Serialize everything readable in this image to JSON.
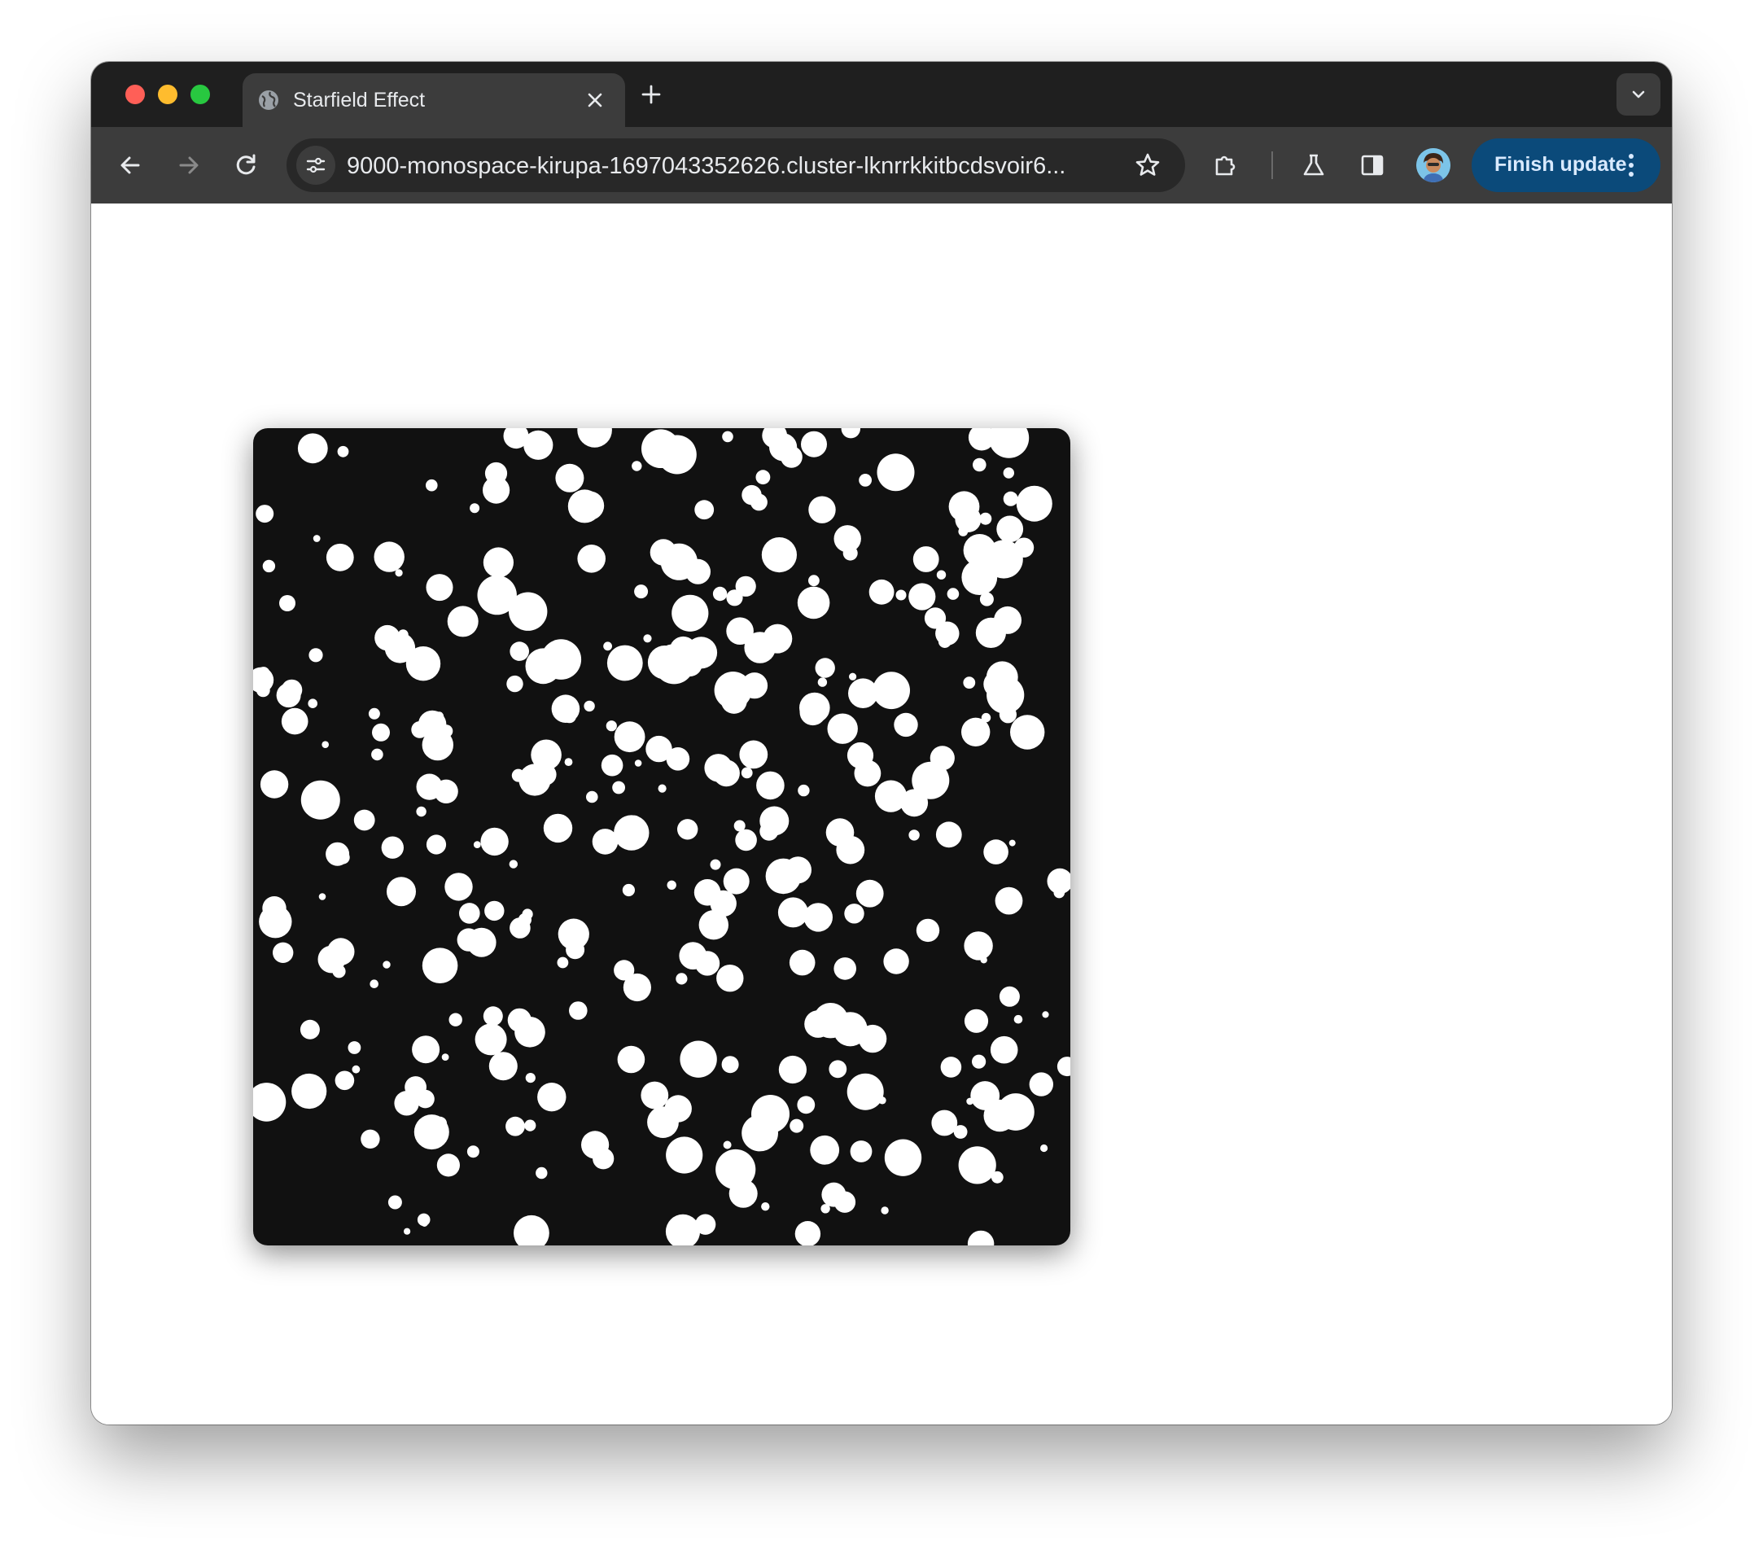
{
  "browser": {
    "tab": {
      "title": "Starfield Effect",
      "favicon": "globe-icon",
      "close_icon": "close-icon"
    },
    "new_tab_icon": "plus-icon",
    "tab_search_icon": "chevron-down-icon",
    "toolbar": {
      "back_icon": "arrow-left-icon",
      "forward_icon": "arrow-right-icon",
      "reload_icon": "reload-icon",
      "site_info_icon": "tune-icon",
      "url": "9000-monospace-kirupa-1697043352626.cluster-lknrrkkitbcdsvoir6...",
      "bookmark_icon": "star-icon",
      "extensions_icon": "puzzle-icon",
      "labs_icon": "flask-icon",
      "side_panel_icon": "side-panel-icon",
      "profile_icon": "avatar",
      "update_button_label": "Finish update",
      "menu_icon": "more-vert-icon"
    },
    "colors": {
      "tabbar_bg": "#1f1f1f",
      "toolbar_bg": "#3c3c3c",
      "update_button_bg": "#0b4a7a",
      "starfield_bg": "#111111",
      "star_color": "#ffffff"
    }
  },
  "page": {
    "content": "starfield-canvas",
    "star_count": 340
  }
}
